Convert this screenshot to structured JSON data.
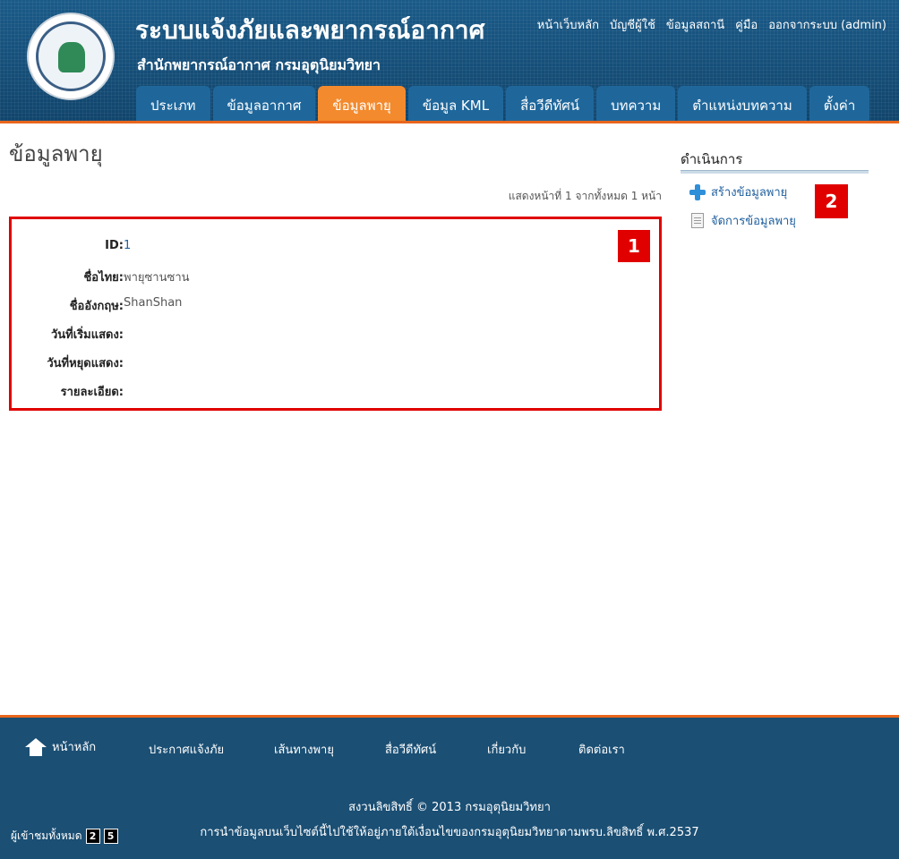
{
  "header": {
    "site_title": "ระบบแจ้งภัยและพยากรณ์อากาศ",
    "site_subtitle": "สำนักพยากรณ์อากาศ กรมอุตุนิยมวิทยา",
    "top_links": [
      "หน้าเว็บหลัก",
      "บัญชีผู้ใช้",
      "ข้อมูลสถานี",
      "คู่มือ",
      "ออกจากระบบ (admin)"
    ],
    "tabs": [
      {
        "label": "ประเภท"
      },
      {
        "label": "ข้อมูลอากาศ"
      },
      {
        "label": "ข้อมูลพายุ"
      },
      {
        "label": "ข้อมูล KML"
      },
      {
        "label": "สื่อวีดีทัศน์"
      },
      {
        "label": "บทความ"
      },
      {
        "label": "ตำแหน่งบทความ"
      },
      {
        "label": "ตั้งค่า"
      }
    ],
    "active_tab": "ข้อมูลพายุ"
  },
  "main": {
    "page_title": "ข้อมูลพายุ",
    "pager_text": "แสดงหน้าที่ 1 จากทั้งหมด 1 หน้า",
    "detail_badge": "1",
    "fields": [
      {
        "label": "ID:",
        "value": "1"
      },
      {
        "label": "ชื่อไทย:",
        "value": "พายุซานซาน"
      },
      {
        "label": "ชื่ออังกฤษ:",
        "value": "ShanShan"
      },
      {
        "label": "วันที่เริ่มแสดง:",
        "value": ""
      },
      {
        "label": "วันที่หยุดแสดง:",
        "value": ""
      },
      {
        "label": "รายละเอียด:",
        "value": ""
      }
    ]
  },
  "sidebar": {
    "title": "ดำเนินการ",
    "badge": "2",
    "actions": [
      {
        "label": "สร้างข้อมูลพายุ",
        "icon": "plus-icon"
      },
      {
        "label": "จัดการข้อมูลพายุ",
        "icon": "document-icon"
      }
    ]
  },
  "footer": {
    "nav": [
      "หน้าหลัก",
      "ประกาศแจ้งภัย",
      "เส้นทางพายุ",
      "สื่อวีดีทัศน์",
      "เกี่ยวกับ",
      "ติดต่อเรา"
    ],
    "copyright": "สงวนลิขสิทธิ์ © 2013 กรมอุตุนิยมวิทยา",
    "notice": "การนำข้อมูลบนเว็บไซต์นี้ไปใช้ให้อยู่ภายใต้เงื่อนไขของกรมอุตุนิยมวิทยาตามพรบ.ลิขสิทธิ์ พ.ศ.2537",
    "visitors_label": "ผู้เข้าชมทั้งหมด",
    "visitor_digits": [
      "2",
      "5"
    ]
  },
  "colors": {
    "header_bg": "#154f7a",
    "accent_orange": "#f38a2d",
    "tab_bg": "#1f679b",
    "highlight_red": "#e00000",
    "link_blue": "#1f5f9e"
  }
}
